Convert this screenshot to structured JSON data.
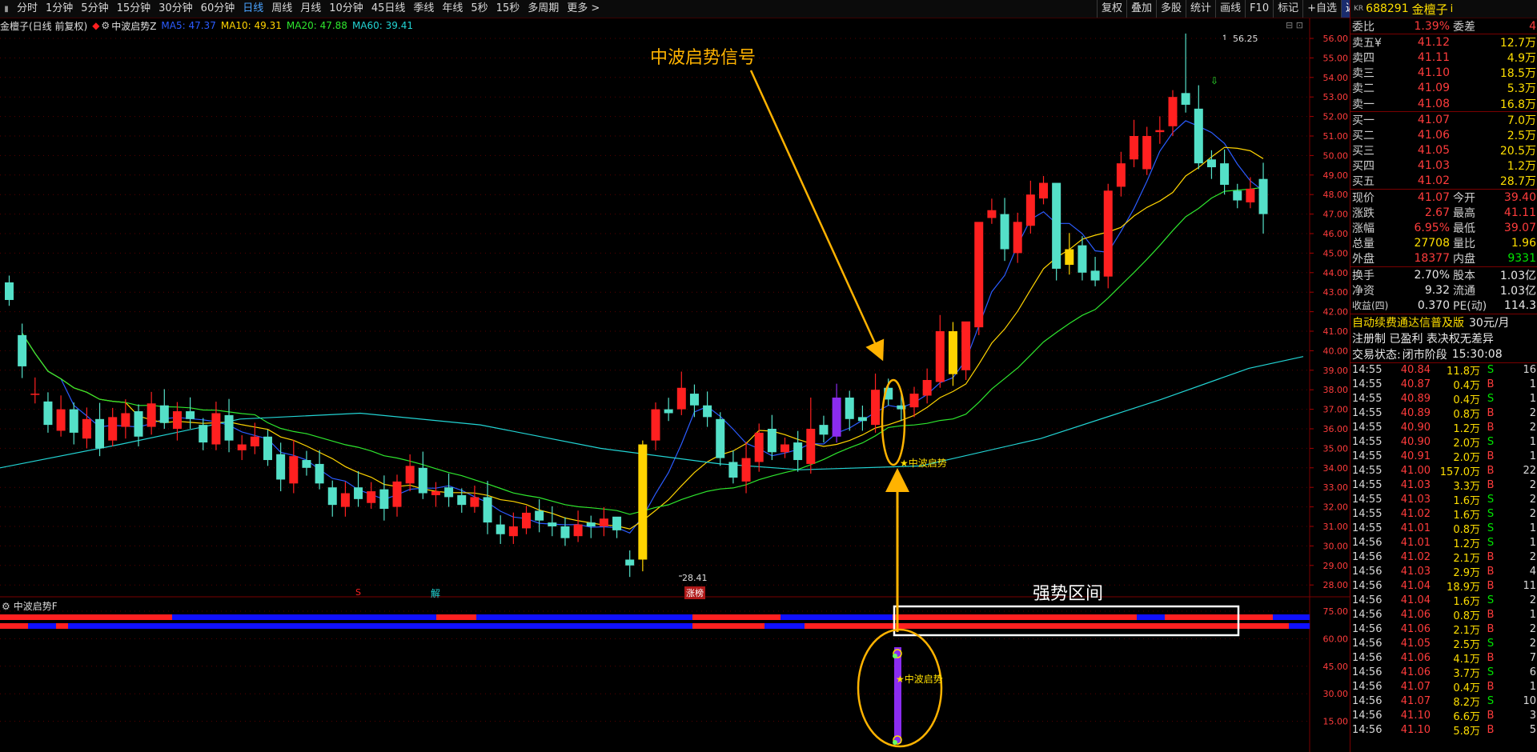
{
  "toolbar": {
    "periods": [
      "分时",
      "1分钟",
      "5分钟",
      "15分钟",
      "30分钟",
      "60分钟",
      "日线",
      "周线",
      "月线",
      "10分钟",
      "45日线",
      "季线",
      "年线",
      "5秒",
      "15秒",
      "多周期",
      "更多 >"
    ],
    "active": "日线",
    "right_buttons": [
      "复权",
      "叠加",
      "多股",
      "统计",
      "画线",
      "F10",
      "标记",
      "+自选",
      "返回"
    ]
  },
  "main_chart": {
    "title": "金檀子(日线 前复权)",
    "indicator": "中波启势Z",
    "ma5": "MA5: 47.37",
    "ma10": "MA10: 49.31",
    "ma20": "MA20: 47.88",
    "ma60": "MA60: 39.41",
    "high_label": "56.25",
    "low_label": "28.41",
    "signal_text": "★中波启势",
    "annotation": "中波启势信号",
    "marker_s": "S",
    "marker_jie": "解",
    "marker_zhangting": "涨榜",
    "y_ticks": [
      "56.00",
      "55.00",
      "54.00",
      "53.00",
      "52.00",
      "51.00",
      "50.00",
      "49.00",
      "48.00",
      "47.00",
      "46.00",
      "45.00",
      "44.00",
      "43.00",
      "42.00",
      "41.00",
      "40.00",
      "39.00",
      "38.00",
      "37.00",
      "36.00",
      "35.00",
      "34.00",
      "33.00",
      "32.00",
      "31.00",
      "30.00",
      "29.00",
      "28.00"
    ]
  },
  "sub_chart": {
    "title": "中波启势F",
    "signal_text": "★中波启势",
    "zone_label": "强势区间",
    "y_ticks": [
      "75.00",
      "60.00",
      "45.00",
      "30.00",
      "15.00"
    ]
  },
  "colors": {
    "up": "#ff2020",
    "down": "#54e0c8",
    "yellow": "#ffd400",
    "purple": "#8b2cf0",
    "accent": "#ffb300"
  },
  "panel": {
    "kr": "KR",
    "code": "688291",
    "name": "金檀子",
    "name_suffix": "i",
    "weibi": {
      "label": "委比",
      "value": "1.39%",
      "label2": "委差",
      "value2": "4"
    },
    "asks": [
      {
        "label": "卖五",
        "flag": "¥",
        "price": "41.12",
        "vol": "12.7万"
      },
      {
        "label": "卖四",
        "flag": "",
        "price": "41.11",
        "vol": "4.9万"
      },
      {
        "label": "卖三",
        "flag": "",
        "price": "41.10",
        "vol": "18.5万"
      },
      {
        "label": "卖二",
        "flag": "",
        "price": "41.09",
        "vol": "5.3万"
      },
      {
        "label": "卖一",
        "flag": "",
        "price": "41.08",
        "vol": "16.8万"
      }
    ],
    "bids": [
      {
        "label": "买一",
        "price": "41.07",
        "vol": "7.0万"
      },
      {
        "label": "买二",
        "price": "41.06",
        "vol": "2.5万"
      },
      {
        "label": "买三",
        "price": "41.05",
        "vol": "20.5万"
      },
      {
        "label": "买四",
        "price": "41.03",
        "vol": "1.2万"
      },
      {
        "label": "买五",
        "price": "41.02",
        "vol": "28.7万"
      }
    ],
    "quote": [
      {
        "l1": "现价",
        "v1": "41.07",
        "c1": "red",
        "l2": "今开",
        "v2": "39.40",
        "c2": "red"
      },
      {
        "l1": "涨跌",
        "v1": "2.67",
        "c1": "red",
        "l2": "最高",
        "v2": "41.11",
        "c2": "red"
      },
      {
        "l1": "涨幅",
        "v1": "6.95%",
        "c1": "red",
        "l2": "最低",
        "v2": "39.07",
        "c2": "red"
      },
      {
        "l1": "总量",
        "v1": "27708",
        "c1": "yellow",
        "l2": "量比",
        "v2": "1.96",
        "c2": "yellow"
      },
      {
        "l1": "外盘",
        "v1": "18377",
        "c1": "red",
        "l2": "内盘",
        "v2": "9331",
        "c2": "green"
      }
    ],
    "finance": [
      {
        "l1": "换手",
        "v1": "2.70%",
        "l2": "股本",
        "v2": "1.03亿"
      },
      {
        "l1": "净资",
        "v1": "9.32",
        "l2": "流通",
        "v2": "1.03亿"
      },
      {
        "l1": "收益(四)",
        "v1": "0.370",
        "l2": "PE(动)",
        "v2": "114.3"
      }
    ],
    "promo1": "自动续费通达信普及版",
    "promo1_price": "30元/月",
    "promo2": "注册制 已盈利 表决权无差异",
    "trade_status_label": "交易状态:",
    "trade_status": "闭市阶段",
    "trade_time": "15:30:08",
    "ticks": [
      {
        "t": "14:55",
        "p": "40.84",
        "v": "11.8万",
        "bs": "S",
        "n": "16"
      },
      {
        "t": "14:55",
        "p": "40.87",
        "v": "0.4万",
        "bs": "B",
        "n": "1"
      },
      {
        "t": "14:55",
        "p": "40.89",
        "v": "0.4万",
        "bs": "S",
        "n": "1"
      },
      {
        "t": "14:55",
        "p": "40.89",
        "v": "0.8万",
        "bs": "B",
        "n": "2"
      },
      {
        "t": "14:55",
        "p": "40.90",
        "v": "1.2万",
        "bs": "B",
        "n": "2"
      },
      {
        "t": "14:55",
        "p": "40.90",
        "v": "2.0万",
        "bs": "S",
        "n": "1"
      },
      {
        "t": "14:55",
        "p": "40.91",
        "v": "2.0万",
        "bs": "B",
        "n": "1"
      },
      {
        "t": "14:55",
        "p": "41.00",
        "v": "157.0万",
        "bs": "B",
        "n": "22"
      },
      {
        "t": "14:55",
        "p": "41.03",
        "v": "3.3万",
        "bs": "B",
        "n": "2"
      },
      {
        "t": "14:55",
        "p": "41.03",
        "v": "1.6万",
        "bs": "S",
        "n": "2"
      },
      {
        "t": "14:55",
        "p": "41.02",
        "v": "1.6万",
        "bs": "S",
        "n": "2"
      },
      {
        "t": "14:55",
        "p": "41.01",
        "v": "0.8万",
        "bs": "S",
        "n": "1"
      },
      {
        "t": "14:56",
        "p": "41.01",
        "v": "1.2万",
        "bs": "S",
        "n": "1"
      },
      {
        "t": "14:56",
        "p": "41.02",
        "v": "2.1万",
        "bs": "B",
        "n": "2"
      },
      {
        "t": "14:56",
        "p": "41.03",
        "v": "2.9万",
        "bs": "B",
        "n": "4"
      },
      {
        "t": "14:56",
        "p": "41.04",
        "v": "18.9万",
        "bs": "B",
        "n": "11"
      },
      {
        "t": "14:56",
        "p": "41.04",
        "v": "1.6万",
        "bs": "S",
        "n": "2"
      },
      {
        "t": "14:56",
        "p": "41.06",
        "v": "0.8万",
        "bs": "B",
        "n": "1"
      },
      {
        "t": "14:56",
        "p": "41.06",
        "v": "2.1万",
        "bs": "B",
        "n": "2"
      },
      {
        "t": "14:56",
        "p": "41.05",
        "v": "2.5万",
        "bs": "S",
        "n": "2"
      },
      {
        "t": "14:56",
        "p": "41.06",
        "v": "4.1万",
        "bs": "B",
        "n": "7"
      },
      {
        "t": "14:56",
        "p": "41.06",
        "v": "3.7万",
        "bs": "S",
        "n": "6"
      },
      {
        "t": "14:56",
        "p": "41.07",
        "v": "0.4万",
        "bs": "B",
        "n": "1"
      },
      {
        "t": "14:56",
        "p": "41.07",
        "v": "8.2万",
        "bs": "S",
        "n": "10"
      },
      {
        "t": "14:56",
        "p": "41.10",
        "v": "6.6万",
        "bs": "B",
        "n": "3"
      },
      {
        "t": "14:56",
        "p": "41.10",
        "v": "5.8万",
        "bs": "B",
        "n": "5"
      }
    ]
  }
}
